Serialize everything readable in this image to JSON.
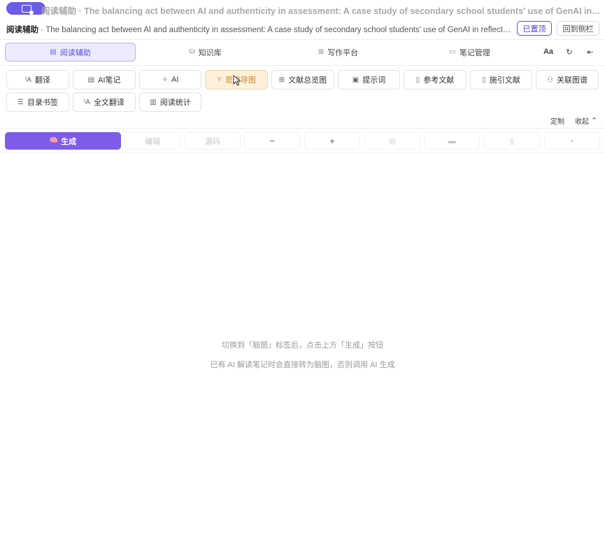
{
  "window": {
    "title": "阅读辅助 · The balancing act between AI and authenticity in assessment: A case study of secondary school students' use of GenAI in reflective wr..."
  },
  "header": {
    "title_strong": "阅读辅助",
    "title_rest": " · The balancing act between AI and authenticity in assessment: A case study of secondary school students' use of GenAI in reflective wri...",
    "pinned_label": "已置顶",
    "back_label": "回到侧栏"
  },
  "tabs": [
    {
      "label": "阅读辅助",
      "icon": "document-icon",
      "active": true
    },
    {
      "label": "知识库",
      "icon": "database-icon",
      "active": false
    },
    {
      "label": "写作平台",
      "icon": "grid-icon",
      "active": false
    },
    {
      "label": "笔记管理",
      "icon": "folder-icon",
      "active": false
    }
  ],
  "tab_tools": {
    "font_label": "Aa",
    "refresh_icon": "refresh-icon",
    "collapse_icon": "collapse-left-icon"
  },
  "features": [
    {
      "label": "翻译",
      "icon": "translate-icon"
    },
    {
      "label": "AI笔记",
      "icon": "note-icon"
    },
    {
      "label": "AI",
      "icon": "sparkle-icon"
    },
    {
      "label": "思维导图",
      "icon": "mindmap-icon",
      "highlight": true
    },
    {
      "label": "文献总览图",
      "icon": "grid-icon"
    },
    {
      "label": "提示词",
      "icon": "chat-icon"
    },
    {
      "label": "参考文献",
      "icon": "file-icon"
    },
    {
      "label": "施引文献",
      "icon": "file-icon"
    },
    {
      "label": "关联图谱",
      "icon": "graph-icon"
    },
    {
      "label": "目录书签",
      "icon": "list-icon"
    },
    {
      "label": "全文翻译",
      "icon": "translate-icon"
    },
    {
      "label": "阅读统计",
      "icon": "chart-icon"
    }
  ],
  "panel": {
    "customize_label": "定制",
    "collapse_label": "收起"
  },
  "toolbar": {
    "generate_label": "生成",
    "edit_label": "编辑",
    "source_label": "源码",
    "zoom_out_label": "−",
    "zoom_in_label": "+"
  },
  "empty_state": {
    "line1": "切换到「脑图」标签后，点击上方「生成」按钮",
    "line2": "已有 AI 解读笔记时会直接转为脑图，否则调用 AI 生成"
  },
  "colors": {
    "accent": "#6b5ce7",
    "generate": "#7e5ce8",
    "highlight_bg": "#fdf1dc",
    "highlight_text": "#c98a2a"
  }
}
